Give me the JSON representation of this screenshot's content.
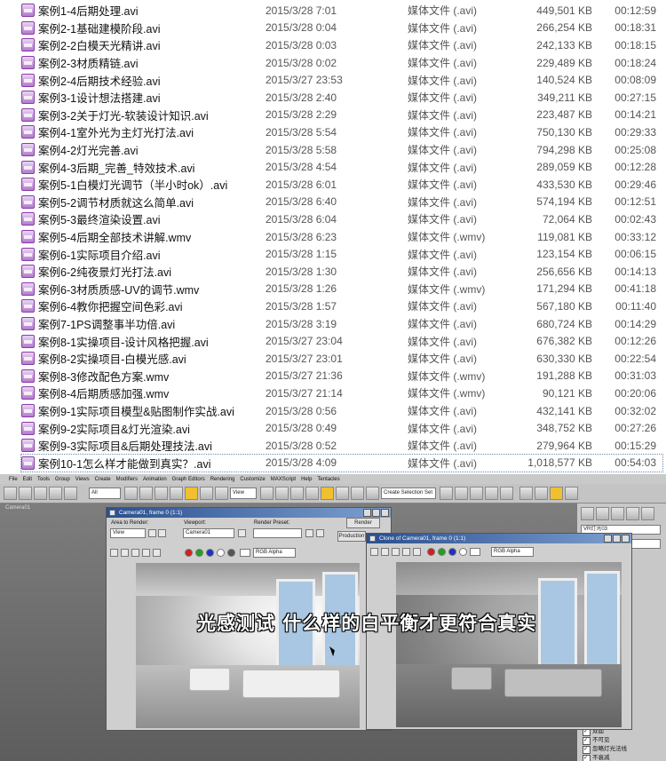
{
  "files": [
    {
      "name": "案例1-4后期处理.avi",
      "date": "2015/3/28 7:01",
      "type": "媒体文件 (.avi)",
      "size": "449,501 KB",
      "duration": "00:12:59"
    },
    {
      "name": "案例2-1基础建模阶段.avi",
      "date": "2015/3/28 0:04",
      "type": "媒体文件 (.avi)",
      "size": "266,254 KB",
      "duration": "00:18:31"
    },
    {
      "name": "案例2-2白模天光精讲.avi",
      "date": "2015/3/28 0:03",
      "type": "媒体文件 (.avi)",
      "size": "242,133 KB",
      "duration": "00:18:15"
    },
    {
      "name": "案例2-3材质精链.avi",
      "date": "2015/3/28 0:02",
      "type": "媒体文件 (.avi)",
      "size": "229,489 KB",
      "duration": "00:18:24"
    },
    {
      "name": "案例2-4后期技术经验.avi",
      "date": "2015/3/27 23:53",
      "type": "媒体文件 (.avi)",
      "size": "140,524 KB",
      "duration": "00:08:09"
    },
    {
      "name": "案例3-1设计想法搭建.avi",
      "date": "2015/3/28 2:40",
      "type": "媒体文件 (.avi)",
      "size": "349,211 KB",
      "duration": "00:27:15"
    },
    {
      "name": "案例3-2关于灯光-软装设计知识.avi",
      "date": "2015/3/28 2:29",
      "type": "媒体文件 (.avi)",
      "size": "223,487 KB",
      "duration": "00:14:21"
    },
    {
      "name": "案例4-1室外光为主灯光打法.avi",
      "date": "2015/3/28 5:54",
      "type": "媒体文件 (.avi)",
      "size": "750,130 KB",
      "duration": "00:29:33"
    },
    {
      "name": "案例4-2灯光完善.avi",
      "date": "2015/3/28 5:58",
      "type": "媒体文件 (.avi)",
      "size": "794,298 KB",
      "duration": "00:25:08"
    },
    {
      "name": "案例4-3后期_完善_特效技术.avi",
      "date": "2015/3/28 4:54",
      "type": "媒体文件 (.avi)",
      "size": "289,059 KB",
      "duration": "00:12:28"
    },
    {
      "name": "案例5-1白模灯光调节（半小时ok）.avi",
      "date": "2015/3/28 6:01",
      "type": "媒体文件 (.avi)",
      "size": "433,530 KB",
      "duration": "00:29:46"
    },
    {
      "name": "案例5-2调节材质就这么简单.avi",
      "date": "2015/3/28 6:40",
      "type": "媒体文件 (.avi)",
      "size": "574,194 KB",
      "duration": "00:12:51"
    },
    {
      "name": "案例5-3最终渲染设置.avi",
      "date": "2015/3/28 6:04",
      "type": "媒体文件 (.avi)",
      "size": "72,064 KB",
      "duration": "00:02:43"
    },
    {
      "name": "案例5-4后期全部技术讲解.wmv",
      "date": "2015/3/28 6:23",
      "type": "媒体文件 (.wmv)",
      "size": "119,081 KB",
      "duration": "00:33:12"
    },
    {
      "name": "案例6-1实际项目介绍.avi",
      "date": "2015/3/28 1:15",
      "type": "媒体文件 (.avi)",
      "size": "123,154 KB",
      "duration": "00:06:15"
    },
    {
      "name": "案例6-2纯夜景灯光打法.avi",
      "date": "2015/3/28 1:30",
      "type": "媒体文件 (.avi)",
      "size": "256,656 KB",
      "duration": "00:14:13"
    },
    {
      "name": "案例6-3材质质感-UV的调节.wmv",
      "date": "2015/3/28 1:26",
      "type": "媒体文件 (.wmv)",
      "size": "171,294 KB",
      "duration": "00:41:18"
    },
    {
      "name": "案例6-4教你把握空间色彩.avi",
      "date": "2015/3/28 1:57",
      "type": "媒体文件 (.avi)",
      "size": "567,180 KB",
      "duration": "00:11:40"
    },
    {
      "name": "案例7-1PS调整事半功倍.avi",
      "date": "2015/3/28 3:19",
      "type": "媒体文件 (.avi)",
      "size": "680,724 KB",
      "duration": "00:14:29"
    },
    {
      "name": "案例8-1实操项目-设计风格把握.avi",
      "date": "2015/3/27 23:04",
      "type": "媒体文件 (.avi)",
      "size": "676,382 KB",
      "duration": "00:12:26"
    },
    {
      "name": "案例8-2实操项目-白模光感.avi",
      "date": "2015/3/27 23:01",
      "type": "媒体文件 (.avi)",
      "size": "630,330 KB",
      "duration": "00:22:54"
    },
    {
      "name": "案例8-3修改配色方案.wmv",
      "date": "2015/3/27 21:36",
      "type": "媒体文件 (.wmv)",
      "size": "191,288 KB",
      "duration": "00:31:03"
    },
    {
      "name": "案例8-4后期质感加强.wmv",
      "date": "2015/3/27 21:14",
      "type": "媒体文件 (.wmv)",
      "size": "90,121 KB",
      "duration": "00:20:06"
    },
    {
      "name": "案例9-1实际项目模型&贴图制作实战.avi",
      "date": "2015/3/28 0:56",
      "type": "媒体文件 (.avi)",
      "size": "432,141 KB",
      "duration": "00:32:02"
    },
    {
      "name": "案例9-2实际项目&灯光渲染.avi",
      "date": "2015/3/28 0:49",
      "type": "媒体文件 (.avi)",
      "size": "348,752 KB",
      "duration": "00:27:26"
    },
    {
      "name": "案例9-3实际项目&后期处理技法.avi",
      "date": "2015/3/28 0:52",
      "type": "媒体文件 (.avi)",
      "size": "279,964 KB",
      "duration": "00:15:29"
    },
    {
      "name": "案例10-1怎么样才能做到真实？.avi",
      "date": "2015/3/28 4:09",
      "type": "媒体文件 (.avi)",
      "size": "1,018,577 KB",
      "duration": "00:54:03",
      "selected": true
    }
  ],
  "max": {
    "menu": [
      "File",
      "Edit",
      "Tools",
      "Group",
      "Views",
      "Create",
      "Modifiers",
      "Animation",
      "Graph Editors",
      "Rendering",
      "Customize",
      "MAXScript",
      "Help",
      "Tentacles"
    ],
    "toolbar": {
      "filter": "All",
      "view": "View",
      "selection_set": "Create Selection Set"
    },
    "viewport_label": "Camera01",
    "cmd_panel": {
      "object_name": "VR灯光03",
      "modifier_list": "Modifier List",
      "checks": [
        "双面",
        "不可见",
        "忽略灯光法线",
        "不衰减"
      ]
    },
    "frame1": {
      "title": "Camera01, frame 0 (1:1)",
      "area_label": "Area to Render:",
      "area_value": "View",
      "viewport_label": "Viewport:",
      "viewport_value": "Camera01",
      "preset_label": "Render Preset:",
      "preset_value": "",
      "render_button": "Render",
      "production_button": "Production",
      "channel": "RGB Alpha"
    },
    "frame2": {
      "title": "Clone of Camera01, frame 0 (1:1)",
      "channel": "RGB Alpha"
    },
    "caption": "光感测试 什么样的白平衡才更符合真实"
  }
}
